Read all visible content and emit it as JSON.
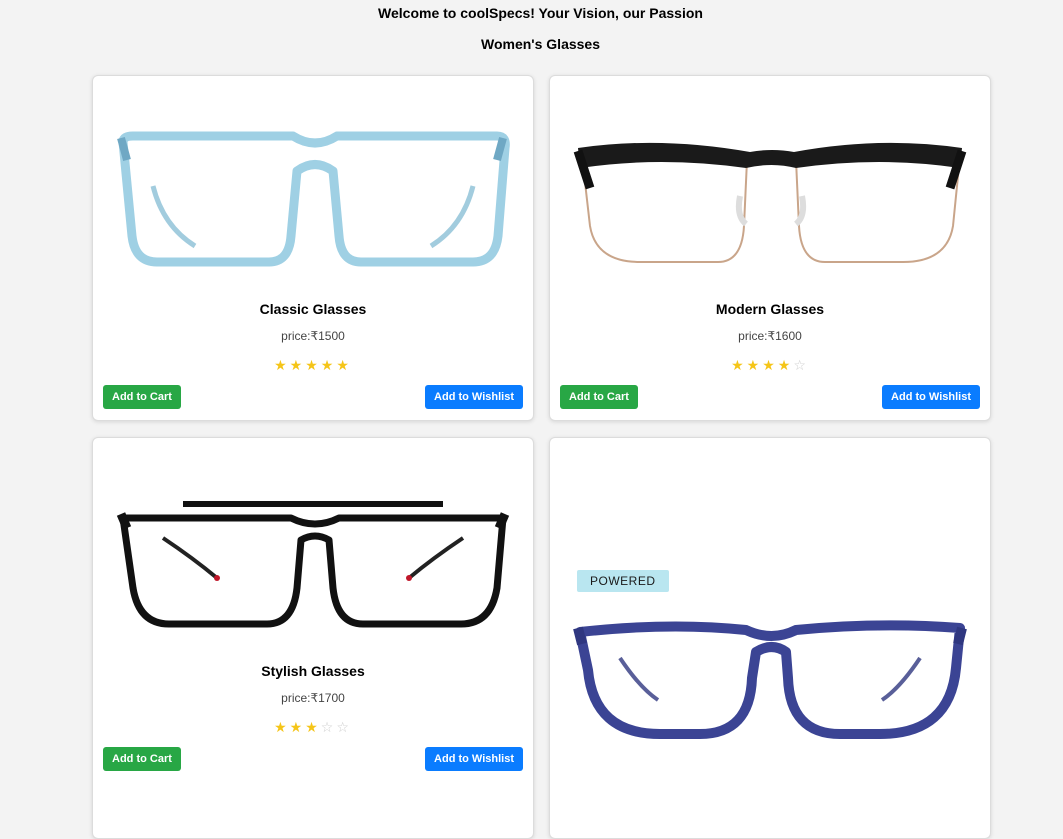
{
  "header": {
    "welcome": "Welcome to coolSpecs! Your Vision, our Passion",
    "section_title": "Women's Glasses"
  },
  "products": [
    {
      "name": "Classic Glasses",
      "price": "price:₹1500",
      "rating": 5,
      "max_rating": 5,
      "cart_label": "Add to Cart",
      "wishlist_label": "Add to Wishlist",
      "frame_color": "#a9d4e6"
    },
    {
      "name": "Modern Glasses",
      "price": "price:₹1600",
      "rating": 4,
      "max_rating": 5,
      "cart_label": "Add to Cart",
      "wishlist_label": "Add to Wishlist",
      "frame_color": "#1a1a1a"
    },
    {
      "name": "Stylish Glasses",
      "price": "price:₹1700",
      "rating": 3,
      "max_rating": 5,
      "cart_label": "Add to Cart",
      "wishlist_label": "Add to Wishlist",
      "frame_color": "#111111"
    },
    {
      "badge": "POWERED",
      "frame_color": "#3b4494"
    }
  ],
  "colors": {
    "cart_button": "#28a745",
    "wishlist_button": "#0a7cff",
    "star_on": "#f5c518",
    "star_off": "#cfcfcf"
  }
}
